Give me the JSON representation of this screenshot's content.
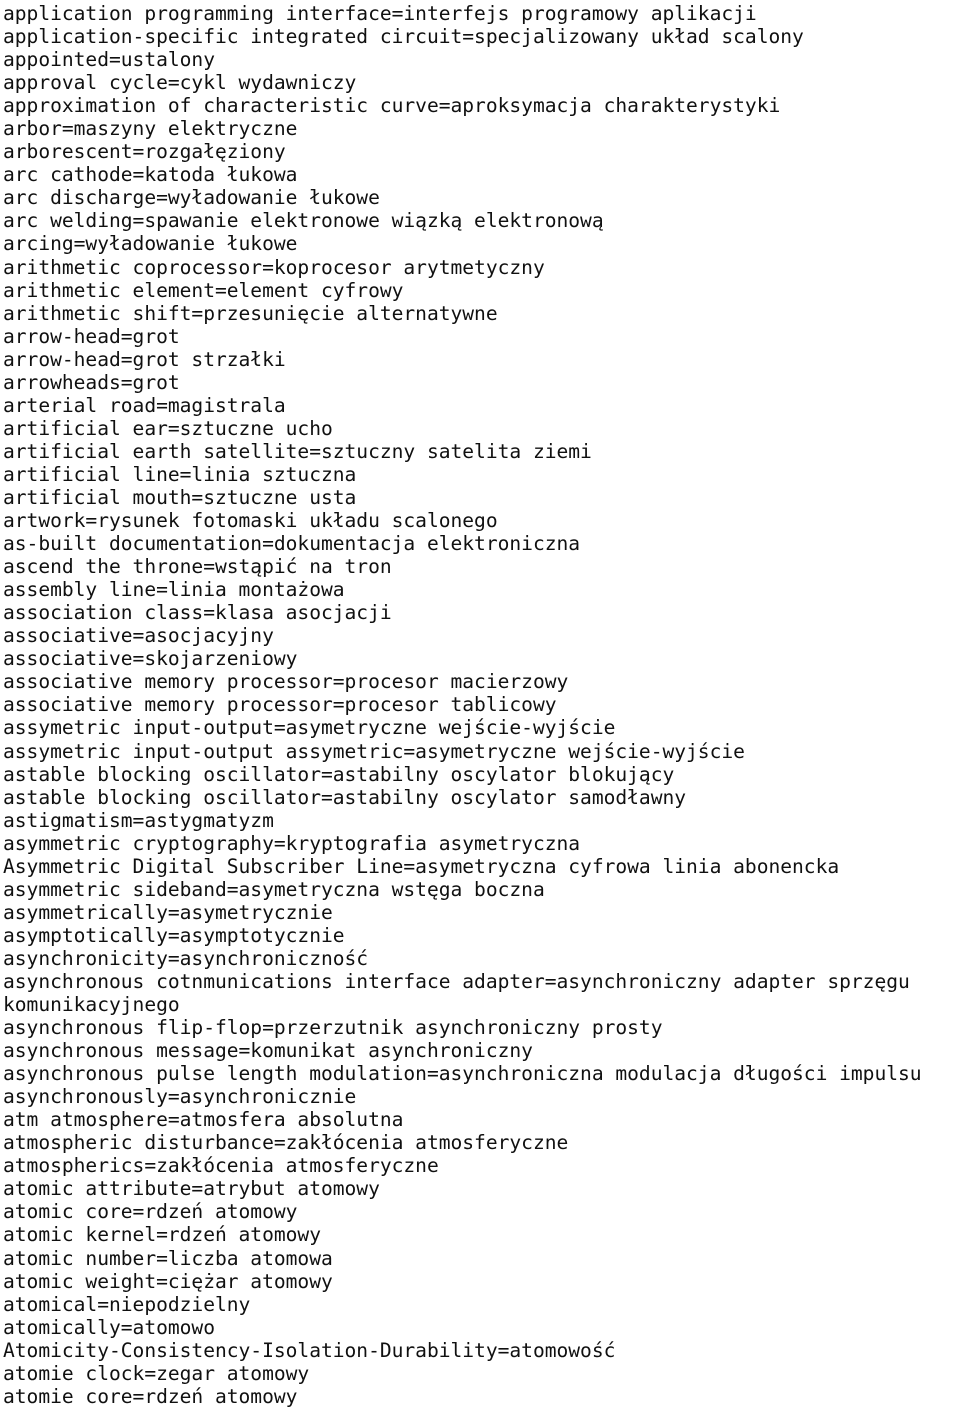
{
  "document": {
    "kind": "glossary-text-page",
    "language_pair": "English=Polish",
    "background_color": "#ffffff",
    "text_color": "#101010",
    "lines": [
      "application programming interface=interfejs programowy aplikacji",
      "application-specific integrated circuit=specjalizowany układ scalony",
      "appointed=ustalony",
      "approval cycle=cykl wydawniczy",
      "approximation of characteristic curve=aproksymacja charakterystyki",
      "arbor=maszyny elektryczne",
      "arborescent=rozgałęziony",
      "arc cathode=katoda łukowa",
      "arc discharge=wyładowanie łukowe",
      "arc welding=spawanie elektronowe wiązką elektronową",
      "arcing=wyładowanie łukowe",
      "arithmetic coprocessor=koprocesor arytmetyczny",
      "arithmetic element=element cyfrowy",
      "arithmetic shift=przesunięcie alternatywne",
      "arrow-head=grot",
      "arrow-head=grot strzałki",
      "arrowheads=grot",
      "arterial road=magistrala",
      "artificial ear=sztuczne ucho",
      "artificial earth satellite=sztuczny satelita ziemi",
      "artificial line=linia sztuczna",
      "artificial mouth=sztuczne usta",
      "artwork=rysunek fotomaski układu scalonego",
      "as-built documentation=dokumentacja elektroniczna",
      "ascend the throne=wstąpić na tron",
      "assembly line=linia montażowa",
      "association class=klasa asocjacji",
      "associative=asocjacyjny",
      "associative=skojarzeniowy",
      "associative memory processor=procesor macierzowy",
      "associative memory processor=procesor tablicowy",
      "assymetric input-output=asymetryczne wejście-wyjście",
      "assymetric input-output assymetric=asymetryczne wejście-wyjście",
      "astable blocking oscillator=astabilny oscylator blokujący",
      "astable blocking oscillator=astabilny oscylator samodławny",
      "astigmatism=astygmatyzm",
      "asymmetric cryptography=kryptografia asymetryczna",
      "Asymmetric Digital Subscriber Line=asymetryczna cyfrowa linia abonencka",
      "asymmetric sideband=asymetryczna wstęga boczna",
      "asymmetrically=asymetrycznie",
      "asymptotically=asymptotycznie",
      "asynchronicity=asynchroniczność",
      "asynchronous cotnmunications interface adapter=asynchroniczny adapter sprzęgu",
      "komunikacyjnego",
      "asynchronous flip-flop=przerzutnik asynchroniczny prosty",
      "asynchronous message=komunikat asynchroniczny",
      "asynchronous pulse length modulation=asynchroniczna modulacja długości impulsu",
      "asynchronously=asynchronicznie",
      "atm atmosphere=atmosfera absolutna",
      "atmospheric disturbance=zakłócenia atmosferyczne",
      "atmospherics=zakłócenia atmosferyczne",
      "atomic attribute=atrybut atomowy",
      "atomic core=rdzeń atomowy",
      "atomic kernel=rdzeń atomowy",
      "atomic number=liczba atomowa",
      "atomic weight=ciężar atomowy",
      "atomical=niepodzielny",
      "atomically=atomowo",
      "Atomicity-Consistency-Isolation-Durability=atomowość",
      "atomie clock=zegar atomowy",
      "atomie core=rdzeń atomowy"
    ]
  }
}
